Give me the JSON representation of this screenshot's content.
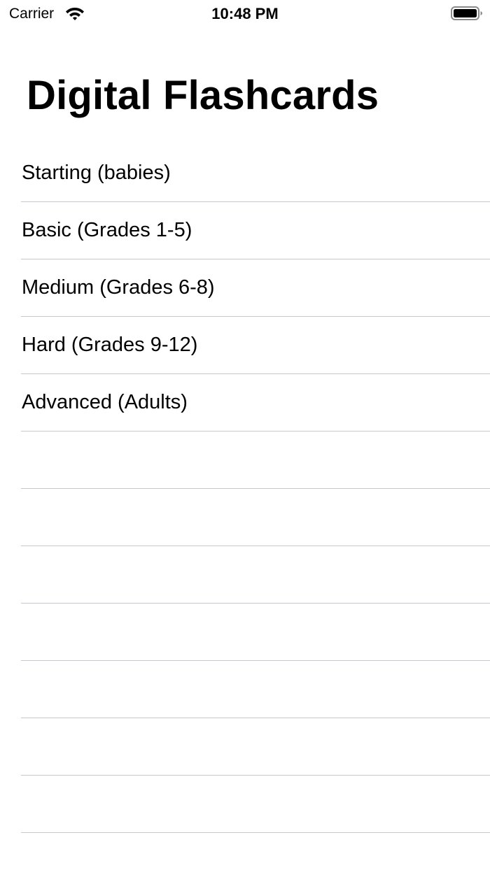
{
  "status_bar": {
    "carrier": "Carrier",
    "time": "10:48 PM",
    "wifi_icon": "wifi-icon",
    "battery_icon": "battery-icon"
  },
  "header": {
    "title": "Digital Flashcards"
  },
  "list": {
    "items": [
      {
        "label": "Starting (babies)"
      },
      {
        "label": "Basic (Grades 1-5)"
      },
      {
        "label": "Medium (Grades 6-8)"
      },
      {
        "label": "Hard (Grades 9-12)"
      },
      {
        "label": "Advanced (Adults)"
      }
    ],
    "empty_rows": 7
  },
  "colors": {
    "background": "#ffffff",
    "text": "#000000",
    "separator": "#c8c7cc"
  }
}
